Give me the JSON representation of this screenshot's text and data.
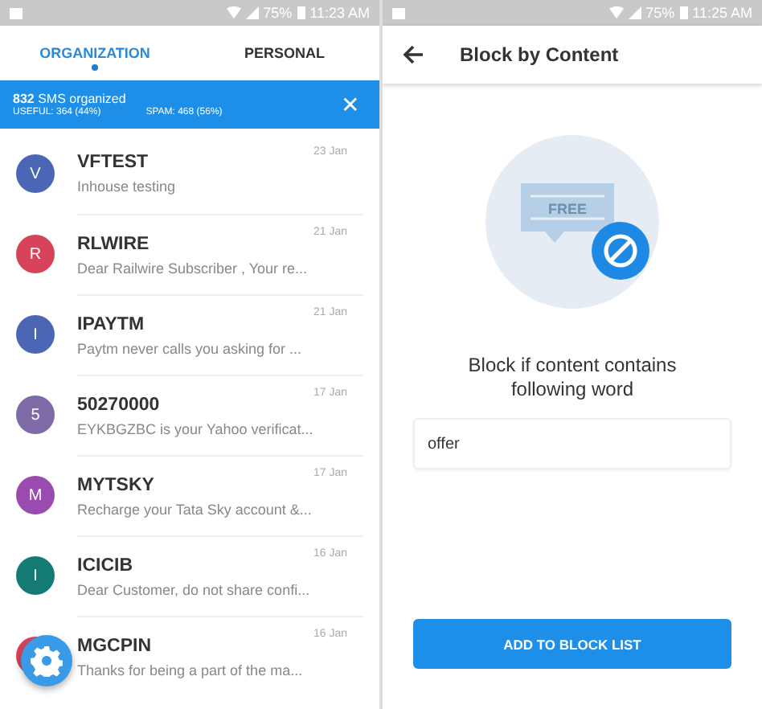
{
  "left_screen": {
    "status_bar": {
      "battery": "75%",
      "time": "11:23 AM"
    },
    "tabs": [
      {
        "label": "ORGANIZATION",
        "selected": true
      },
      {
        "label": "PERSONAL",
        "selected": false
      }
    ],
    "banner": {
      "title": "**832** SMS organized",
      "useful": "USEFUL: 364 (44%)",
      "spam": "SPAM: 468 (56%)",
      "close": "✕"
    },
    "messages": [
      {
        "initial": "V",
        "color": "#4a66b4",
        "sender": "VFTEST",
        "preview": "Inhouse testing",
        "date": "23 Jan"
      },
      {
        "initial": "R",
        "color": "#d6435a",
        "sender": "RLWIRE",
        "preview": "Dear Railwire Subscriber , Your re...",
        "date": "21 Jan"
      },
      {
        "initial": "I",
        "color": "#4a66b4",
        "sender": "IPAYTM",
        "preview": "Paytm never calls you asking for ...",
        "date": "21 Jan"
      },
      {
        "initial": "5",
        "color": "#7d6aa6",
        "sender": "50270000",
        "preview": "EYKBGZBC is your Yahoo verificat...",
        "date": "17 Jan"
      },
      {
        "initial": "M",
        "color": "#9a4bb0",
        "sender": "MYTSKY",
        "preview": "Recharge your Tata Sky account &...",
        "date": "17 Jan"
      },
      {
        "initial": "I",
        "color": "#137a74",
        "sender": "ICICIB",
        "preview": "Dear Customer, do not share confi...",
        "date": "16 Jan"
      },
      {
        "color": "#d6435a",
        "sender": "MGCPIN",
        "preview": "Thanks for being a part of the ma...",
        "date": "16 Jan"
      }
    ]
  },
  "right_screen": {
    "status_bar": {
      "battery": "75%",
      "time": "11:25 AM"
    },
    "title": "Block by Content",
    "illustration_word": "FREE",
    "prompt": "Block if content contains following word",
    "word_field": {
      "value": "offer"
    },
    "button": "ADD TO BLOCK LIST"
  }
}
